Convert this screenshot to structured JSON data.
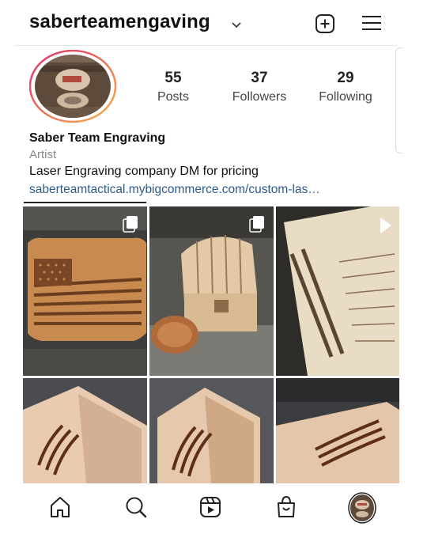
{
  "header": {
    "username": "saberteamengaving"
  },
  "profile": {
    "stats": [
      {
        "value": "55",
        "label": "Posts"
      },
      {
        "value": "37",
        "label": "Followers"
      },
      {
        "value": "29",
        "label": "Following"
      }
    ],
    "name": "Saber Team Engraving",
    "category": "Artist",
    "bio": "Laser Engraving company DM for pricing",
    "link": "saberteamtactical.mybigcommerce.com/custom-las…"
  },
  "icons": {
    "chevron": "chevron-down-icon",
    "new_post": "plus-square-icon",
    "menu": "hamburger-menu-icon",
    "carousel": "carousel-icon",
    "reel": "play-icon"
  },
  "bottom_nav": [
    "home-icon",
    "search-icon",
    "reels-icon",
    "shop-icon",
    "profile-avatar"
  ],
  "colors": {
    "link": "#2e5c8a",
    "story_ring_a": "#e1306c",
    "story_ring_b": "#f7b24a"
  }
}
